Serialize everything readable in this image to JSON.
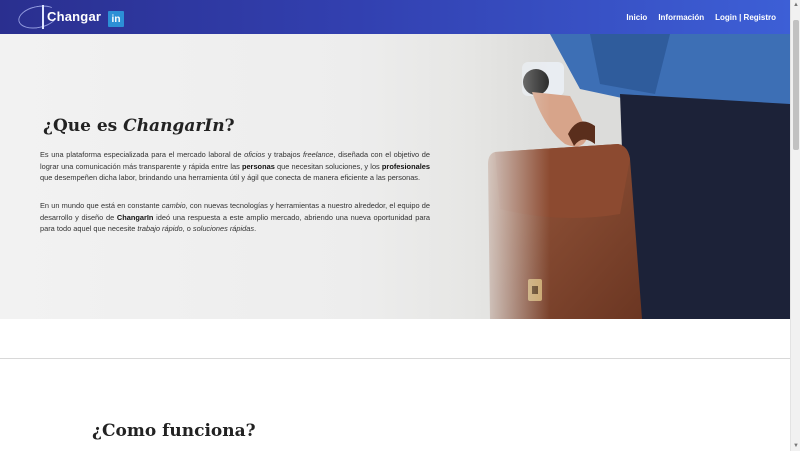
{
  "brand": {
    "name": "Changar",
    "badge": "in"
  },
  "nav": {
    "items": [
      "Inicio",
      "Información",
      "Login | Registro"
    ]
  },
  "hero": {
    "title_prefix": "¿Que es ",
    "title_em": "ChangarIn",
    "title_suffix": "?",
    "p1": [
      {
        "t": "Es una plataforma especializada para el mercado laboral de "
      },
      {
        "t": "oficios",
        "s": "em"
      },
      {
        "t": " y trabajos "
      },
      {
        "t": "freelance",
        "s": "em"
      },
      {
        "t": ", diseñada con el objetivo de lograr una comunicación más transparente y rápida entre las "
      },
      {
        "t": "personas",
        "s": "strong"
      },
      {
        "t": " que necesitan soluciones, y los "
      },
      {
        "t": "profesionales",
        "s": "strong"
      },
      {
        "t": " que desempeñen dicha labor, brindando una herramienta útil y ágil que conecta de manera eficiente a las personas."
      }
    ],
    "p2": [
      {
        "t": "En un mundo que está en constante "
      },
      {
        "t": "cambio",
        "s": "em"
      },
      {
        "t": ", con nuevas tecnologías y herramientas a nuestro alrededor, el equipo de desarrollo y diseño de "
      },
      {
        "t": "ChangarIn",
        "s": "strong"
      },
      {
        "t": " ideó una respuesta a este amplio mercado, abriendo una nueva oportunidad para para todo aquel que necesite "
      },
      {
        "t": "trabajo rápido",
        "s": "em"
      },
      {
        "t": ", o "
      },
      {
        "t": "soluciones rápidas",
        "s": "em"
      },
      {
        "t": "."
      }
    ]
  },
  "how": {
    "title": "¿Como funciona?"
  },
  "colors": {
    "nav_start": "#2a2f8f",
    "nav_end": "#3d5fd6",
    "badge": "#2c8fd6"
  }
}
